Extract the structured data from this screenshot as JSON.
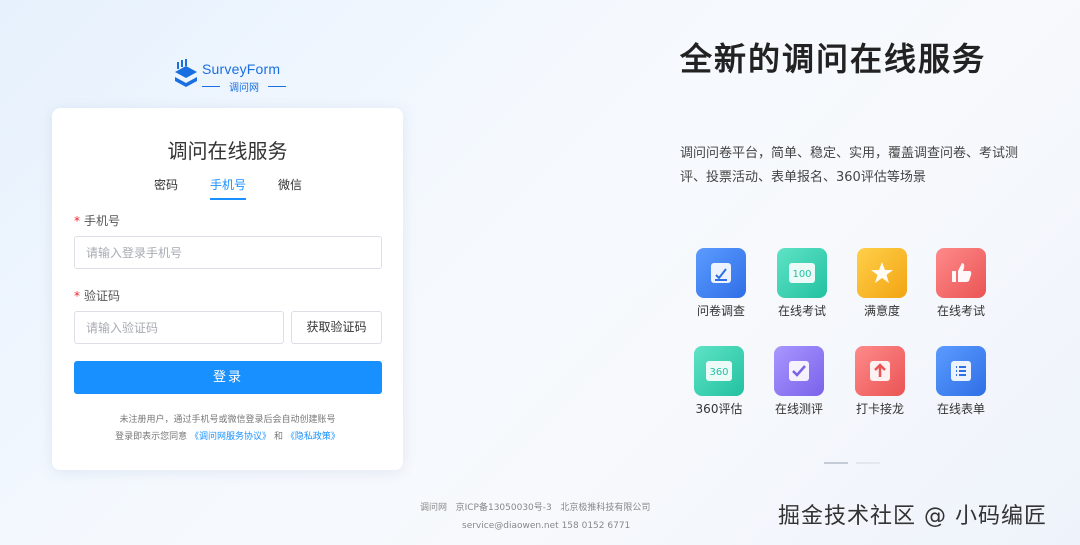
{
  "logo": {
    "name": "SurveyForm",
    "sub": "调问网"
  },
  "login": {
    "title": "调问在线服务",
    "tabs": [
      "密码",
      "手机号",
      "微信"
    ],
    "phone_label": "手机号",
    "phone_placeholder": "请输入登录手机号",
    "code_label": "验证码",
    "code_placeholder": "请输入验证码",
    "get_code_label": "获取验证码",
    "login_label": "登录",
    "note_line1": "未注册用户，通过手机号或微信登录后会自动创建账号",
    "note_prefix": "登录即表示您同意",
    "agreement_link": "《调问网服务协议》",
    "and": "和",
    "privacy_link": "《隐私政策》"
  },
  "hero": {
    "title": "全新的调问在线服务",
    "description": "调问问卷平台，简单、稳定、实用，覆盖调查问卷、考试测评、投票活动、表单报名、360评估等场景"
  },
  "features": [
    {
      "label": "问卷调查",
      "icon": "survey-icon",
      "color": "#3b82f6"
    },
    {
      "label": "在线考试",
      "icon": "exam-100-icon",
      "color": "#34d3b4"
    },
    {
      "label": "满意度",
      "icon": "star-icon",
      "color": "#f5b52a"
    },
    {
      "label": "在线考试",
      "icon": "thumbs-up-icon",
      "color": "#f26a6a"
    },
    {
      "label": "360评估",
      "icon": "360-icon",
      "color": "#34d3b4"
    },
    {
      "label": "在线测评",
      "icon": "check-icon",
      "color": "#8b78f0"
    },
    {
      "label": "打卡接龙",
      "icon": "arrow-up-icon",
      "color": "#f26a6a"
    },
    {
      "label": "在线表单",
      "icon": "form-list-icon",
      "color": "#3b82f6"
    }
  ],
  "footer": {
    "site": "调问网",
    "icp": "京ICP备13050030号-3",
    "company": "北京极推科技有限公司",
    "contact": "service@diaowen.net 158 0152 6771"
  },
  "watermark": "掘金技术社区 @ 小码编匠",
  "colors": {
    "primary": "#1890ff",
    "required": "#f5222d"
  }
}
